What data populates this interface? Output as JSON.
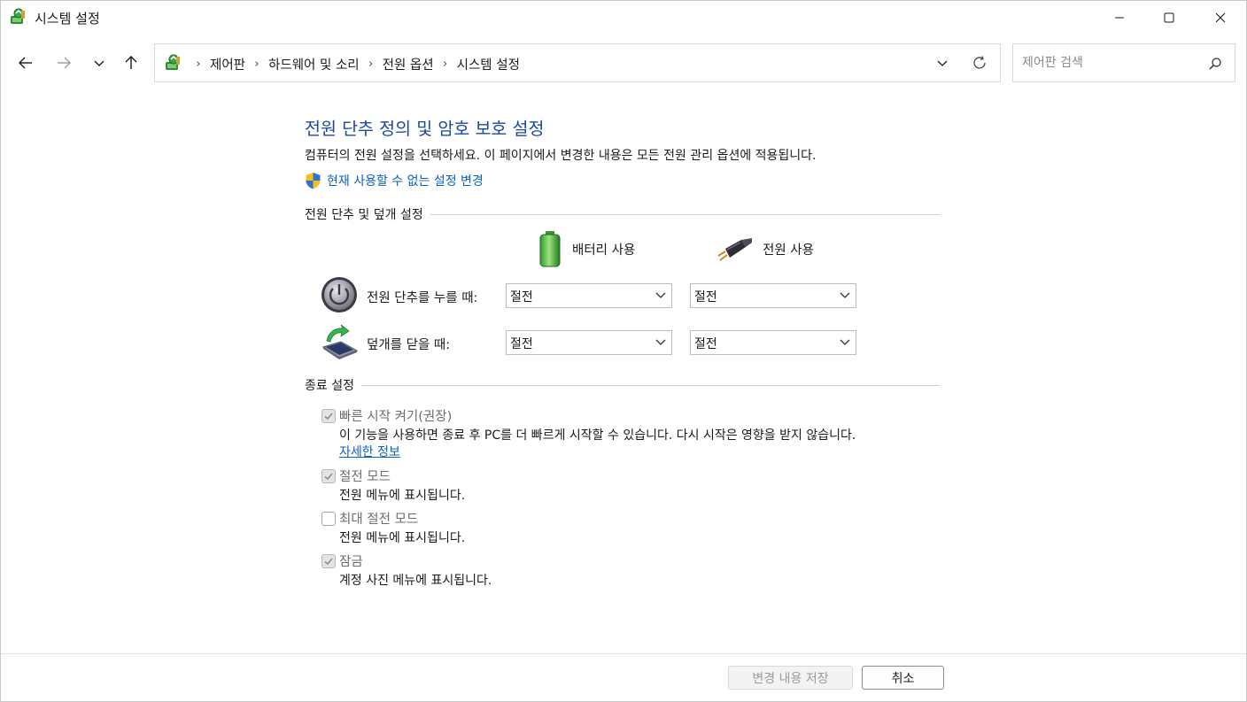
{
  "window": {
    "title": "시스템 설정",
    "controls": {
      "minimize_icon": "minimize-icon",
      "maximize_icon": "maximize-icon",
      "close_icon": "close-icon"
    }
  },
  "nav": {
    "back_icon": "arrow-left-icon",
    "forward_icon": "arrow-right-icon",
    "recent_icon": "chevron-down-icon",
    "up_icon": "arrow-up-icon",
    "breadcrumbs": [
      "제어판",
      "하드웨어 및 소리",
      "전원 옵션",
      "시스템 설정"
    ],
    "refresh_icon": "refresh-icon",
    "search_placeholder": "제어판 검색",
    "search_icon": "search-icon"
  },
  "main": {
    "heading": "전원 단추 정의 및 암호 보호 설정",
    "description": "컴퓨터의 전원 설정을 선택하세요. 이 페이지에서 변경한 내용은 모든 전원 관리 옵션에 적용됩니다.",
    "admin_link": "현재 사용할 수 없는 설정 변경",
    "button_section": {
      "title": "전원 단추 및 덮개 설정",
      "columns": [
        "배터리 사용",
        "전원 사용"
      ],
      "rows": [
        {
          "label": "전원 단추를 누를 때:",
          "battery": "절전",
          "plugged": "절전"
        },
        {
          "label": "덮개를 닫을 때:",
          "battery": "절전",
          "plugged": "절전"
        }
      ]
    },
    "shutdown_section": {
      "title": "종료 설정",
      "fast_startup": {
        "label": "빠른 시작 켜기(권장)",
        "checked": true,
        "description": "이 기능을 사용하면 종료 후 PC를 더 빠르게 시작할 수 있습니다. 다시 시작은 영향을 받지 않습니다.",
        "link": "자세한 정보"
      },
      "sleep": {
        "label": "절전 모드",
        "checked": true,
        "description": "전원 메뉴에 표시됩니다."
      },
      "hibernate": {
        "label": "최대 절전 모드",
        "checked": false,
        "description": "전원 메뉴에 표시됩니다."
      },
      "lock": {
        "label": "잠금",
        "checked": true,
        "description": "계정 사진 메뉴에 표시됩니다."
      }
    }
  },
  "footer": {
    "save_label": "변경 내용 저장",
    "cancel_label": "취소"
  },
  "colors": {
    "heading": "#1b4a9c",
    "link": "#0a62c4",
    "disabled_text": "#6d6d6d"
  }
}
